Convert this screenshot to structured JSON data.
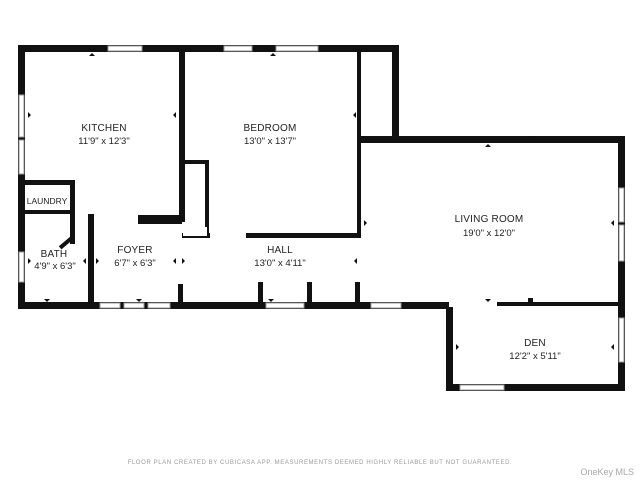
{
  "rooms": {
    "kitchen": {
      "name": "KITCHEN",
      "dim": "11'9\" x 12'3\""
    },
    "bedroom": {
      "name": "BEDROOM",
      "dim": "13'0\" x 13'7\""
    },
    "laundry": {
      "name": "LAUNDRY"
    },
    "bath": {
      "name": "BATH",
      "dim": "4'9\" x 6'3\""
    },
    "foyer": {
      "name": "FOYER",
      "dim": "6'7\" x 6'3\""
    },
    "hall": {
      "name": "HALL",
      "dim": "13'0\" x 4'11\""
    },
    "living": {
      "name": "LIVING ROOM",
      "dim": "19'0\" x 12'0\""
    },
    "den": {
      "name": "DEN",
      "dim": "12'2\" x 5'11\""
    }
  },
  "footer": {
    "disclaimer": "FLOOR PLAN CREATED BY CUBICASA APP. MEASUREMENTS DEEMED HIGHLY RELIABLE BUT NOT GUARANTEED."
  },
  "brand": {
    "name": "OneKey MLS"
  },
  "colors": {
    "wall": "#111111",
    "background": "#ffffff",
    "window": "#9a9a9a"
  }
}
